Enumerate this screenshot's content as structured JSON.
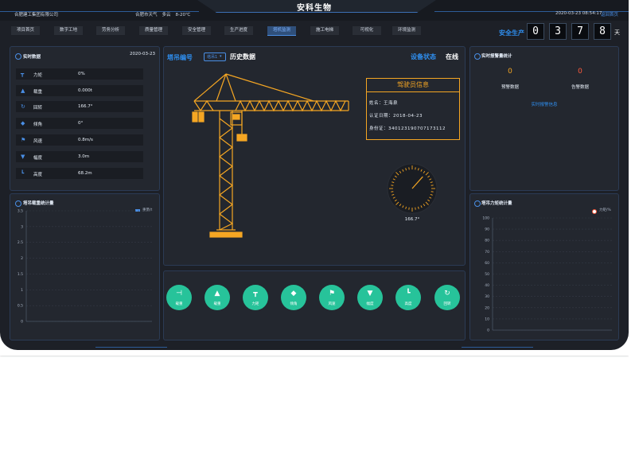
{
  "header": {
    "title": "安科生物",
    "company": "合肥建工集团有限公司",
    "weather": {
      "city": "合肥市天气",
      "condition": "多云",
      "temp": "8-20℃"
    },
    "datetime": "2020-03-23 08:54:17",
    "back_link": "返回首页"
  },
  "nav": {
    "items": [
      {
        "label": "项目首页"
      },
      {
        "label": "数字工地"
      },
      {
        "label": "劳务分析"
      },
      {
        "label": "质量管理"
      },
      {
        "label": "安全管理"
      },
      {
        "label": "生产进度"
      },
      {
        "label": "塔机监测",
        "active": true
      },
      {
        "label": "施工电梯"
      },
      {
        "label": "可视化"
      },
      {
        "label": "环境监测"
      }
    ]
  },
  "safety": {
    "label": "安全生产",
    "digits": [
      "0",
      "3",
      "7",
      "8"
    ],
    "unit": "天"
  },
  "realtime": {
    "title": "实时数据",
    "date": "2020-03-23",
    "rows": [
      {
        "icon": "torque-icon",
        "label": "力矩",
        "value": "0%"
      },
      {
        "icon": "weight-icon",
        "label": "载重",
        "value": "0.000t"
      },
      {
        "icon": "rotation-icon",
        "label": "回转",
        "value": "166.7°"
      },
      {
        "icon": "tilt-icon",
        "label": "倾角",
        "value": "0°"
      },
      {
        "icon": "wind-flag-icon",
        "label": "风速",
        "value": "0.8m/s"
      },
      {
        "icon": "amplitude-icon",
        "label": "幅度",
        "value": "3.0m"
      },
      {
        "icon": "height-icon",
        "label": "高度",
        "value": "68.2m"
      }
    ]
  },
  "center": {
    "tower_label": "塔吊编号",
    "tower_select": "塔吊1",
    "history": "历史数据",
    "status_label": "设备状态",
    "status_value": "在线",
    "driver": {
      "title": "驾驶员信息",
      "name": "姓名：王海泉",
      "cert_date": "认证日期：2018-04-23",
      "id_card": "身份证：340123190707173112"
    },
    "gauge_value": "166.7°",
    "gauge_angle": 166.7
  },
  "buttons": [
    {
      "icon": "torque-icon",
      "label": "载重"
    },
    {
      "icon": "weight-icon",
      "label": "载重"
    },
    {
      "icon": "crane-icon",
      "label": "力矩"
    },
    {
      "icon": "tilt-icon",
      "label": "倾角"
    },
    {
      "icon": "wind-flag-icon",
      "label": "风速"
    },
    {
      "icon": "amplitude-icon",
      "label": "幅度"
    },
    {
      "icon": "height-icon",
      "label": "高度"
    },
    {
      "icon": "rotation-icon",
      "label": "回转"
    }
  ],
  "alarm": {
    "title": "实时报警量统计",
    "warn_value": "0",
    "warn_label": "预警数据",
    "alarm_value": "0",
    "alarm_label": "告警数据",
    "link": "实时报警信息"
  },
  "chart_data": [
    {
      "type": "line",
      "title": "塔吊载重统计量",
      "series": [
        {
          "name": "重量/t",
          "values": []
        }
      ],
      "ylim": [
        0,
        3.5
      ],
      "yticks": [
        "0",
        "0.5",
        "1",
        "1.5",
        "2",
        "2.5",
        "3",
        "3.5"
      ],
      "grid": true,
      "legend": "top-right",
      "color": "#4a8fe6"
    },
    {
      "type": "line",
      "title": "塔吊力矩统计量",
      "series": [
        {
          "name": "力矩/%",
          "values": []
        }
      ],
      "ylim": [
        0,
        100
      ],
      "yticks": [
        "0",
        "10",
        "20",
        "30",
        "40",
        "50",
        "60",
        "70",
        "80",
        "90",
        "100"
      ],
      "grid": true,
      "legend": "top-right",
      "color": "#ffffff"
    }
  ],
  "colors": {
    "accent": "#2f8ff0",
    "orange": "#f5a623",
    "button": "#27c39a",
    "background": "#1d2027"
  }
}
